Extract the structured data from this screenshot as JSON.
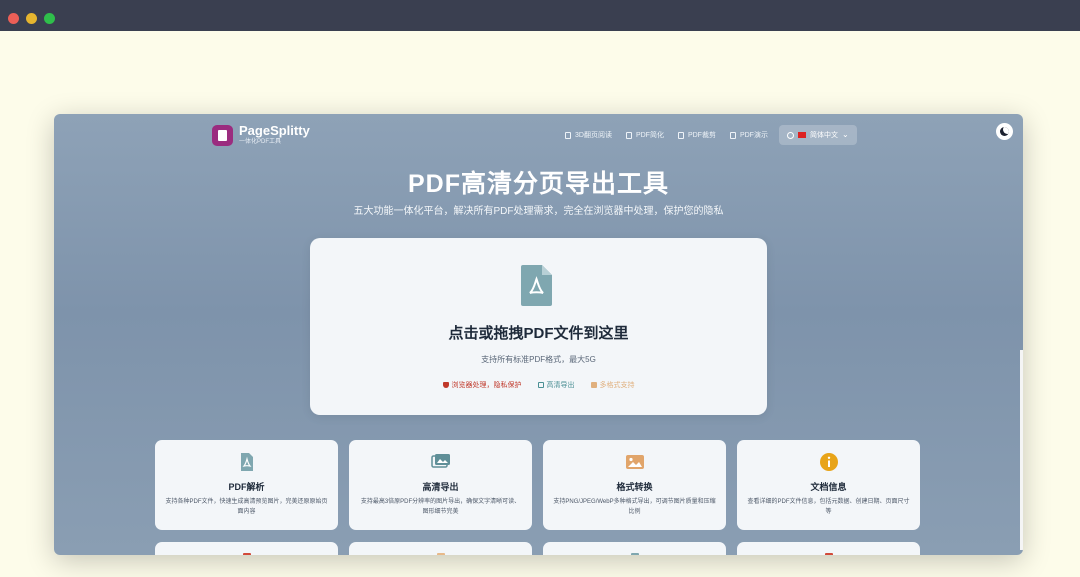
{
  "app": {
    "name": "PageSplitty",
    "tagline": "一体化PDF工具"
  },
  "nav": {
    "items": [
      {
        "label": "3D翻页阅读",
        "icon": "book-icon"
      },
      {
        "label": "PDF简化",
        "icon": "file-icon"
      },
      {
        "label": "PDF裁剪",
        "icon": "crop-icon"
      },
      {
        "label": "PDF演示",
        "icon": "presentation-icon"
      }
    ],
    "language": "简体中文"
  },
  "hero": {
    "title": "PDF高清分页导出工具",
    "subtitle": "五大功能一体化平台，解决所有PDF处理需求，完全在浏览器中处理，保护您的隐私"
  },
  "upload": {
    "title": "点击或拖拽PDF文件到这里",
    "subtitle": "支持所有标准PDF格式，最大5G",
    "features": [
      "浏览器处理，隐私保护",
      "高清导出",
      "多格式支持"
    ]
  },
  "cards": [
    {
      "title": "PDF解析",
      "desc": "支持各种PDF文件，快速生成高清预览图片，完美还原原始页面内容",
      "icon": "pdf-file-icon",
      "color": "#7fa7b0"
    },
    {
      "title": "高清导出",
      "desc": "支持最高3倍原PDF分辨率的图片导出，确保文字清晰可读、图形细节完美",
      "icon": "images-icon",
      "color": "#5f8f98"
    },
    {
      "title": "格式转换",
      "desc": "支持PNG/JPEG/WebP多种格式导出，可调节图片质量和压缩比例",
      "icon": "image-icon",
      "color": "#e1a56b"
    },
    {
      "title": "文档信息",
      "desc": "查看详细的PDF文件信息，包括元数据、创建日期、页面尺寸等",
      "icon": "info-icon",
      "color": "#e8a419"
    }
  ],
  "partial_cards_colors": [
    "#d24a3a",
    "#e8b98a",
    "#7fa7b0",
    "#d24a3a"
  ]
}
